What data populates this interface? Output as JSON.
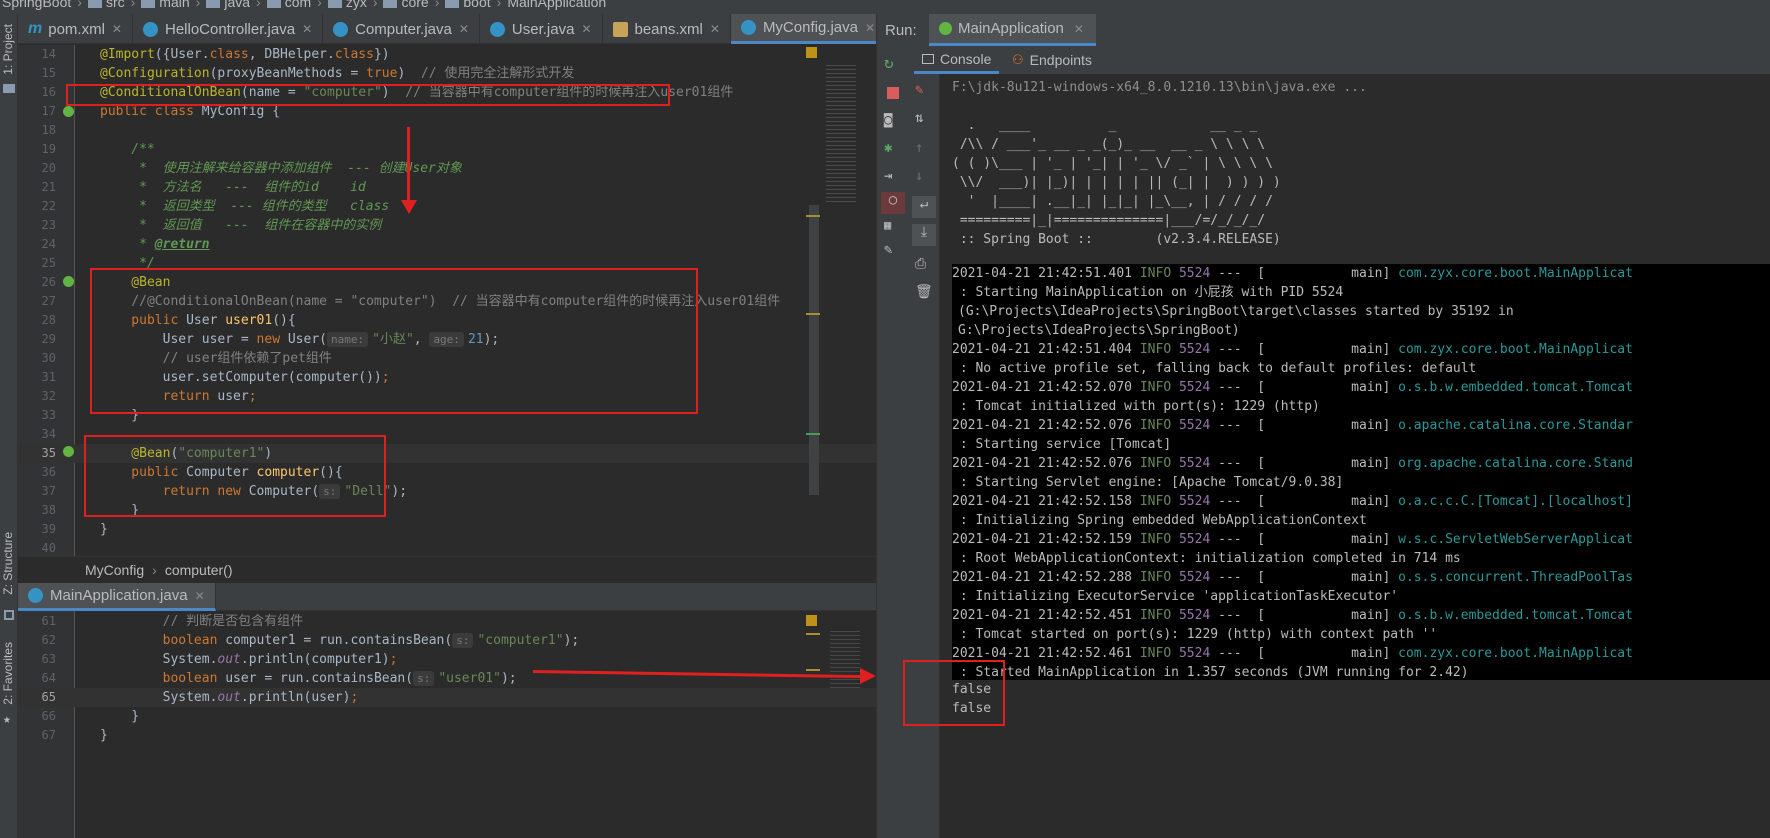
{
  "nav": {
    "crumbs": [
      "SpringBoot",
      "src",
      "main",
      "java",
      "com",
      "zyx",
      "core",
      "boot",
      "MainApplication"
    ]
  },
  "left_strip": {
    "project": "1: Project",
    "structure": "Z: Structure",
    "favorites": "2: Favorites"
  },
  "editor_tabs": [
    {
      "label": "pom.xml",
      "icon": "maven-icon"
    },
    {
      "label": "HelloController.java",
      "icon": "class-icon"
    },
    {
      "label": "Computer.java",
      "icon": "class-icon"
    },
    {
      "label": "User.java",
      "icon": "class-icon"
    },
    {
      "label": "beans.xml",
      "icon": "xml-icon"
    },
    {
      "label": "MyConfig.java",
      "icon": "class-icon",
      "active": true
    }
  ],
  "editor": {
    "line_numbers": [
      "14",
      "15",
      "16",
      "17",
      "18",
      "19",
      "20",
      "21",
      "22",
      "23",
      "24",
      "25",
      "26",
      "27",
      "28",
      "29",
      "30",
      "31",
      "32",
      "33",
      "34",
      "35",
      "36",
      "37",
      "38",
      "39",
      "40"
    ],
    "l14_a": "@Import",
    "l14_b": "({User.",
    "l14_c": "class",
    "l14_d": ", DBHelper.",
    "l14_e": "class",
    "l14_f": "})",
    "l15_a": "@Configuration",
    "l15_b": "(proxyBeanMethods = ",
    "l15_c": "true",
    "l15_d": ")  ",
    "l15_e": "// 使用完全注解形式开发",
    "l16_a": "@ConditionalOnBean",
    "l16_b": "(name = ",
    "l16_c": "\"computer\"",
    "l16_d": ")  ",
    "l16_e": "// 当容器中有computer组件的时候再注入user01组件",
    "l17_a": "public class ",
    "l17_b": "MyConfig {",
    "l19": "    /**",
    "l20": "     *  使用注解来给容器中添加组件  --- 创建User对象",
    "l21": "     *  方法名   ---  组件的id    id",
    "l22": "     *  返回类型  --- 组件的类型   class",
    "l23": "     *  返回值   ---  组件在容器中的实例",
    "l24_a": "     * ",
    "l24_b": "@return",
    "l25": "     */",
    "l26": "    @Bean",
    "l27": "    //@ConditionalOnBean(name = \"computer\")  // 当容器中有computer组件的时候再注入user01组件",
    "l28_a": "    public ",
    "l28_b": "User ",
    "l28_c": "user01",
    "l28_d": "(){",
    "l29_a": "        User user = ",
    "l29_b": "new ",
    "l29_c": "User(",
    "l29_h1": "name:",
    "l29_d": "\"小赵\"",
    "l29_e": ", ",
    "l29_h2": "age:",
    "l29_f": "21",
    "l29_g": ");",
    "l30": "        // user组件依赖了pet组件",
    "l31_a": "        user.setComputer(computer())",
    "l31_b": ";",
    "l32_a": "        return ",
    "l32_b": "user",
    "l32_c": ";",
    "l33": "    }",
    "l35_a": "    @Bean",
    "l35_b": "(",
    "l35_c": "\"computer1\"",
    "l35_d": ")",
    "l36_a": "    public ",
    "l36_b": "Computer ",
    "l36_c": "computer",
    "l36_d": "(){",
    "l37_a": "        return new ",
    "l37_b": "Computer(",
    "l37_h": "s:",
    "l37_c": "\"Dell\"",
    "l37_d": ");",
    "l38": "    }",
    "l39": "}"
  },
  "editor_crumb": {
    "cls": "MyConfig",
    "method": "computer()"
  },
  "lower_tab": {
    "label": "MainApplication.java"
  },
  "lower_editor": {
    "line_numbers": [
      "61",
      "62",
      "63",
      "64",
      "65",
      "66",
      "67"
    ],
    "l61": "        // 判断是否包含有组件",
    "l62_a": "        boolean ",
    "l62_b": "computer1 = run.containsBean(",
    "l62_h": "s:",
    "l62_c": "\"computer1\"",
    "l62_d": ");",
    "l63_a": "        System.",
    "l63_b": "out",
    "l63_c": ".println(computer1)",
    "l63_d": ";",
    "l64_a": "        boolean ",
    "l64_b": "user = run.containsBean(",
    "l64_h": "s:",
    "l64_c": "\"user01\"",
    "l64_d": ");",
    "l65_a": "        System.",
    "l65_b": "out",
    "l65_c": ".println(user)",
    "l65_d": ";",
    "l66": "    }",
    "l67": "}"
  },
  "run": {
    "label": "Run:",
    "tab": "MainApplication",
    "console_tab": "Console",
    "endpoints_tab": "Endpoints",
    "java_path": "F:\\jdk-8u121-windows-x64_8.0.1210.13\\bin\\java.exe ...",
    "banner": [
      "  .   ____          _            __ _ _",
      " /\\\\ / ___'_ __ _ _(_)_ __  __ _ \\ \\ \\ \\",
      "( ( )\\___ | '_ | '_| | '_ \\/ _` | \\ \\ \\ \\",
      " \\\\/  ___)| |_)| | | | | || (_| |  ) ) ) )",
      "  '  |____| .__|_| |_|_| |_\\__, | / / / /",
      " =========|_|==============|___/=/_/_/_/",
      " :: Spring Boot ::        (v2.3.4.RELEASE)"
    ],
    "logs": [
      {
        "ts": "2021-04-21 21:42:51.401",
        "level": "INFO",
        "pid": "5524",
        "thread": "---  [           main]",
        "cls": "com.zyx.core.boot.MainApplicat",
        "msg": " : Starting MainApplication on 小屁孩 with PID 5524",
        "cont": [
          "(G:\\Projects\\IdeaProjects\\SpringBoot\\target\\classes started by 35192 in",
          "G:\\Projects\\IdeaProjects\\SpringBoot)"
        ]
      },
      {
        "ts": "2021-04-21 21:42:51.404",
        "level": "INFO",
        "pid": "5524",
        "thread": "---  [           main]",
        "cls": "com.zyx.core.boot.MainApplicat",
        "msg": " : No active profile set, falling back to default profiles: default",
        "cont": []
      },
      {
        "ts": "2021-04-21 21:42:52.070",
        "level": "INFO",
        "pid": "5524",
        "thread": "---  [           main]",
        "cls": "o.s.b.w.embedded.tomcat.Tomcat",
        "msg": " : Tomcat initialized with port(s): 1229 (http)",
        "cont": []
      },
      {
        "ts": "2021-04-21 21:42:52.076",
        "level": "INFO",
        "pid": "5524",
        "thread": "---  [           main]",
        "cls": "o.apache.catalina.core.Standar",
        "msg": " : Starting service [Tomcat]",
        "cont": []
      },
      {
        "ts": "2021-04-21 21:42:52.076",
        "level": "INFO",
        "pid": "5524",
        "thread": "---  [           main]",
        "cls": "org.apache.catalina.core.Stand",
        "msg": " : Starting Servlet engine: [Apache Tomcat/9.0.38]",
        "cont": []
      },
      {
        "ts": "2021-04-21 21:42:52.158",
        "level": "INFO",
        "pid": "5524",
        "thread": "---  [           main]",
        "cls": "o.a.c.c.C.[Tomcat].[localhost]",
        "msg": " : Initializing Spring embedded WebApplicationContext",
        "cont": []
      },
      {
        "ts": "2021-04-21 21:42:52.159",
        "level": "INFO",
        "pid": "5524",
        "thread": "---  [           main]",
        "cls": "w.s.c.ServletWebServerApplicat",
        "msg": " : Root WebApplicationContext: initialization completed in 714 ms",
        "cont": []
      },
      {
        "ts": "2021-04-21 21:42:52.288",
        "level": "INFO",
        "pid": "5524",
        "thread": "---  [           main]",
        "cls": "o.s.s.concurrent.ThreadPoolTas",
        "msg": " : Initializing ExecutorService 'applicationTaskExecutor'",
        "cont": []
      },
      {
        "ts": "2021-04-21 21:42:52.451",
        "level": "INFO",
        "pid": "5524",
        "thread": "---  [           main]",
        "cls": "o.s.b.w.embedded.tomcat.Tomcat",
        "msg": " : Tomcat started on port(s): 1229 (http) with context path ''",
        "cont": []
      },
      {
        "ts": "2021-04-21 21:42:52.461",
        "level": "INFO",
        "pid": "5524",
        "thread": "---  [           main]",
        "cls": "com.zyx.core.boot.MainApplicat",
        "msg": " : Started MainApplication in 1.357 seconds (JVM running for 2.42)",
        "cont": []
      }
    ],
    "output": [
      "false",
      "false"
    ]
  },
  "colors": {
    "annotation": "#e02020",
    "accent": "#4a88c7"
  }
}
